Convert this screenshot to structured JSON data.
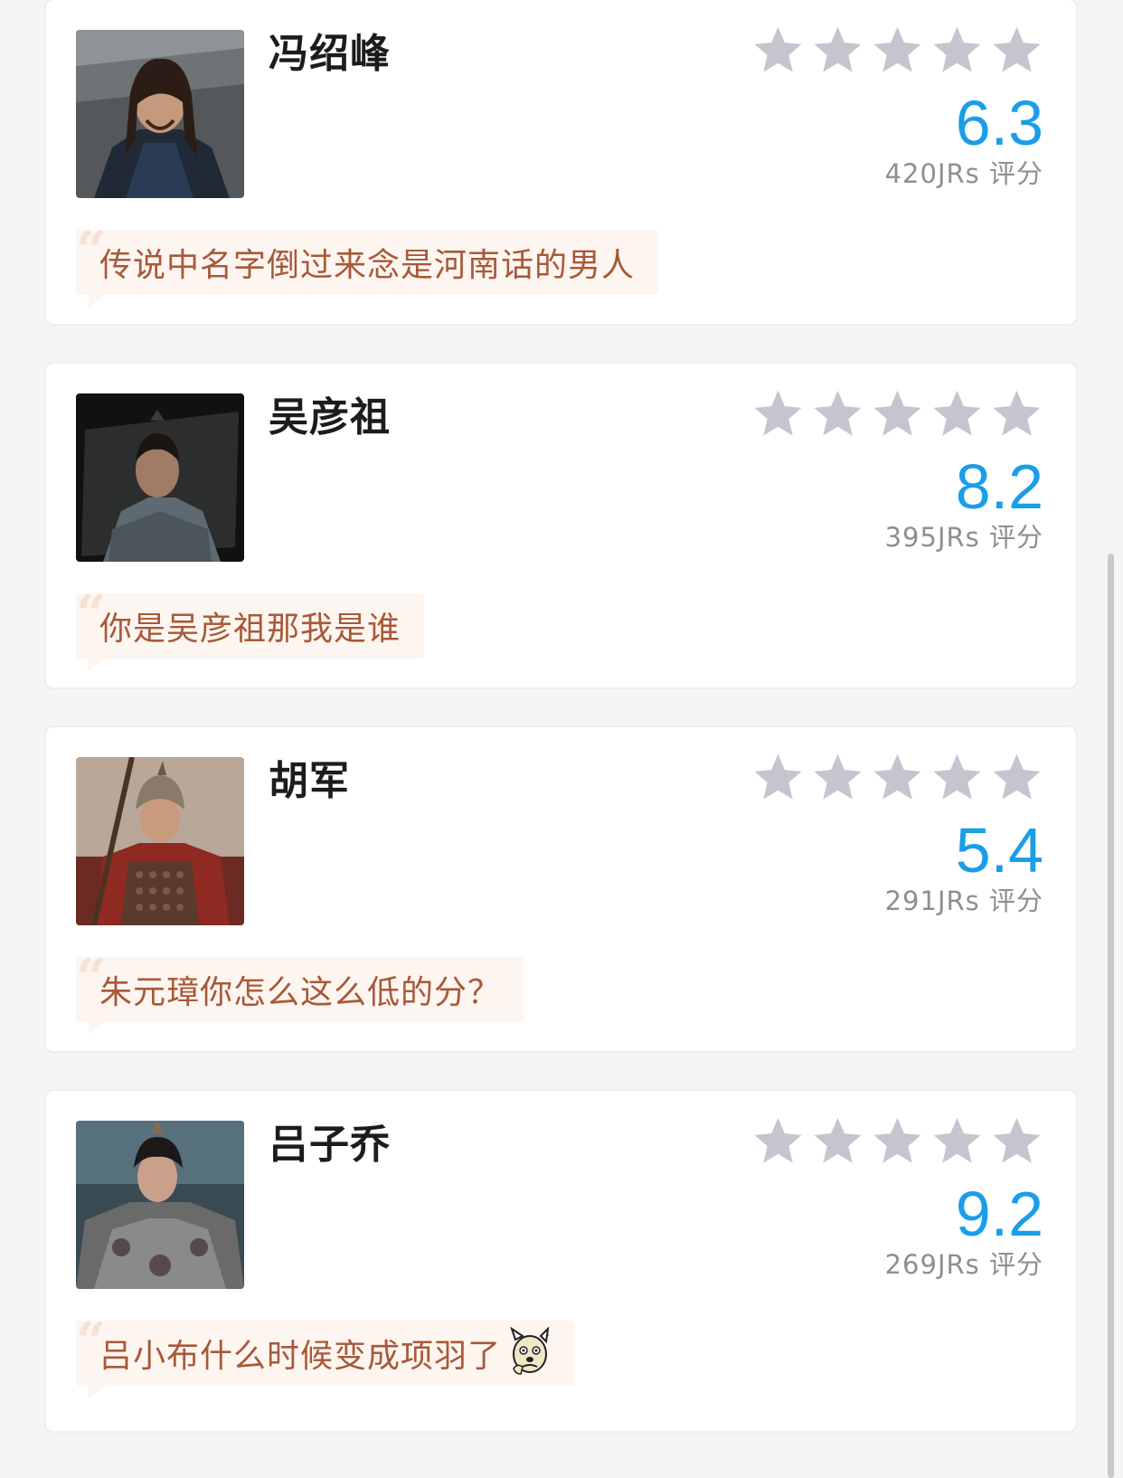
{
  "cards": [
    {
      "name": "冯绍峰",
      "score": "6.3",
      "count": "420JRs 评分",
      "comment": "传说中名字倒过来念是河南话的男人"
    },
    {
      "name": "吴彦祖",
      "score": "8.2",
      "count": "395JRs 评分",
      "comment": "你是吴彦祖那我是谁"
    },
    {
      "name": "胡军",
      "score": "5.4",
      "count": "291JRs 评分",
      "comment": "朱元璋你怎么这么低的分？"
    },
    {
      "name": "吕子乔",
      "score": "9.2",
      "count": "269JRs 评分",
      "comment": "吕小布什么时候变成项羽了"
    }
  ],
  "ratings": {
    "max_stars": 5
  },
  "icons": {
    "star": "star-icon",
    "quote": "quote-icon",
    "emoji": "thinking-dog-emoji"
  },
  "colors": {
    "score": "#1a9ee8",
    "star_inactive": "#c5c5d0",
    "comment_text": "#a7593a",
    "comment_bg": "#fdf5ef"
  }
}
